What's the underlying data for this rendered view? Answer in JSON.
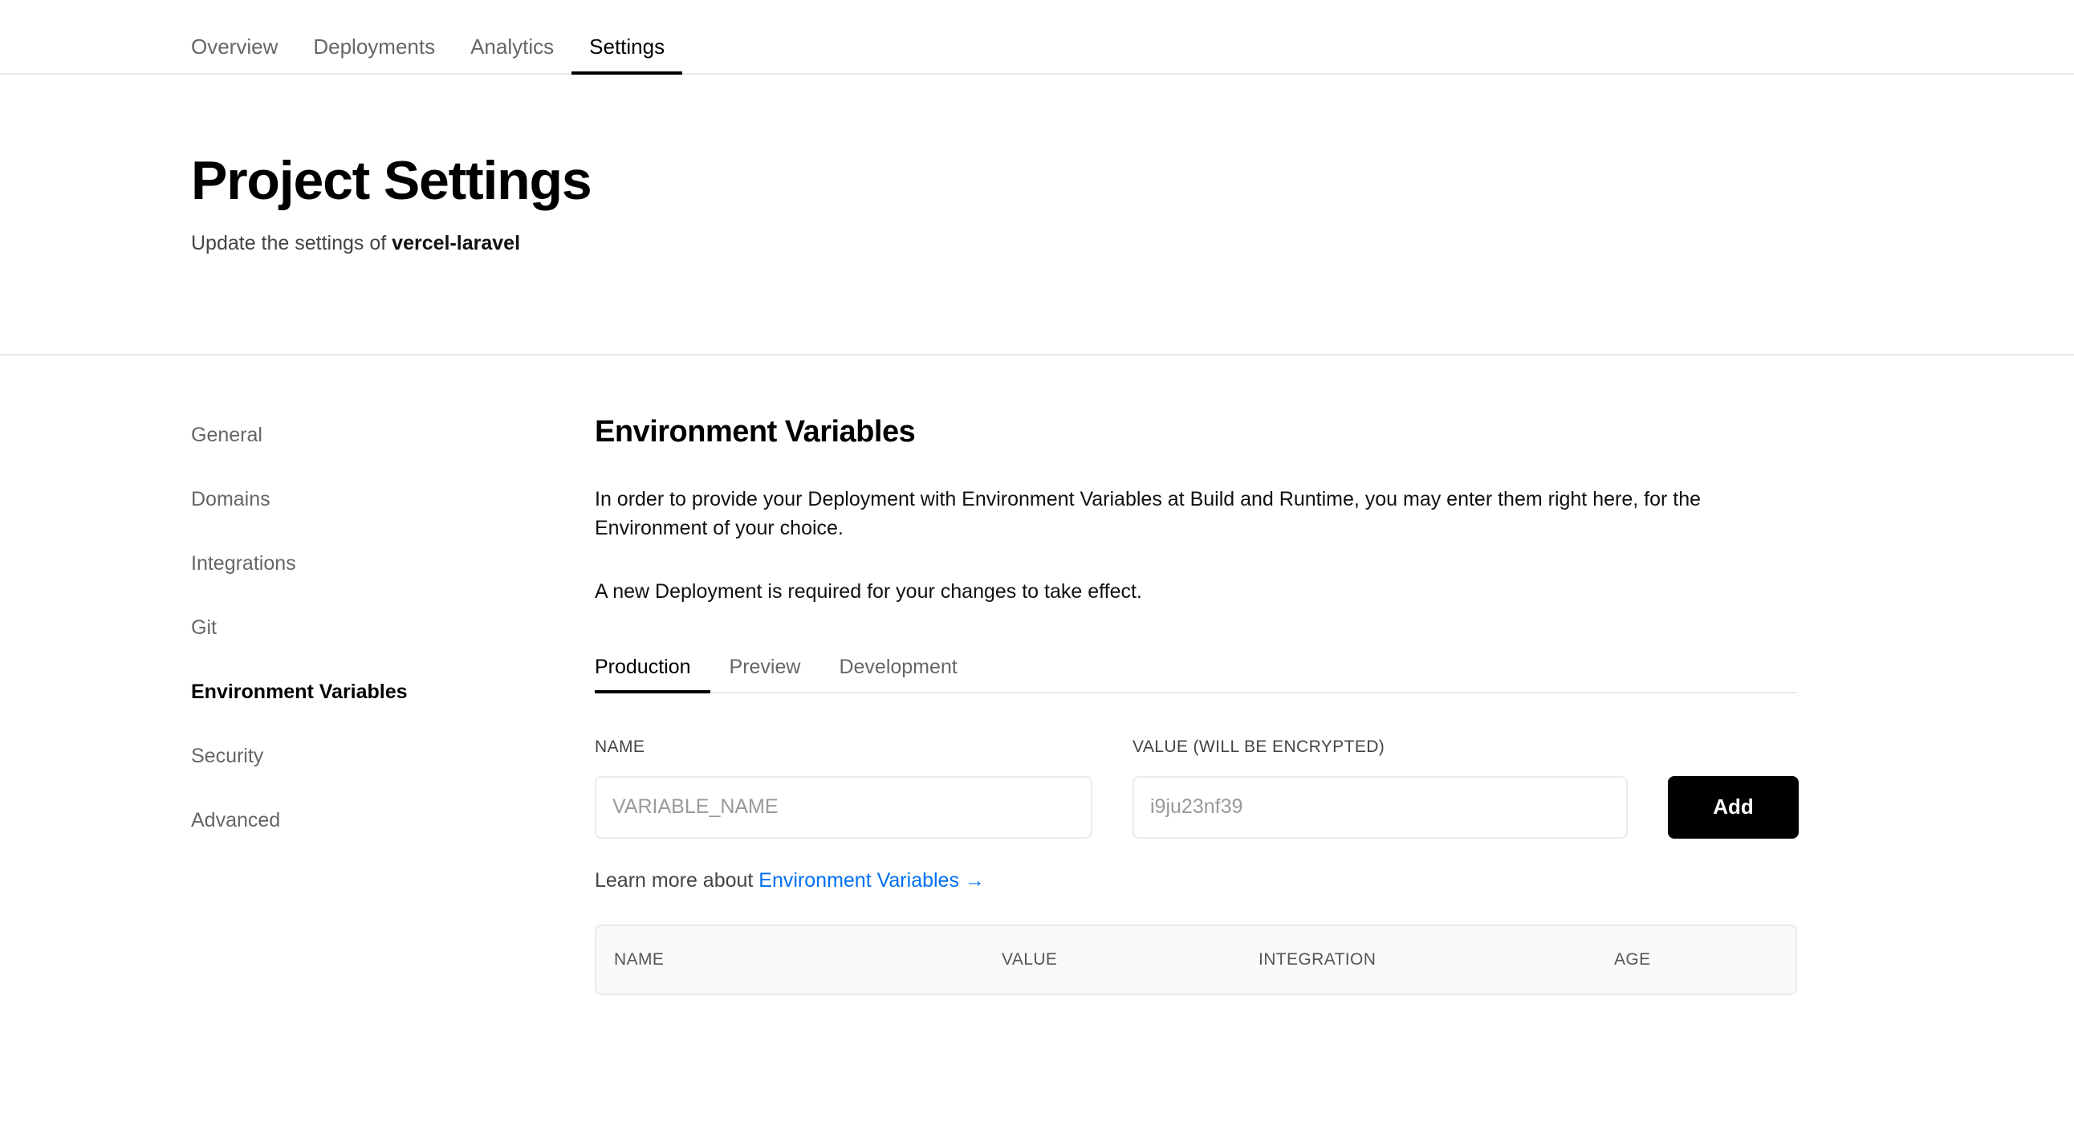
{
  "topnav": {
    "tabs": [
      {
        "label": "Overview",
        "active": false
      },
      {
        "label": "Deployments",
        "active": false
      },
      {
        "label": "Analytics",
        "active": false
      },
      {
        "label": "Settings",
        "active": true
      }
    ]
  },
  "header": {
    "title": "Project Settings",
    "subtitle_prefix": "Update the settings of ",
    "project_name": "vercel-laravel"
  },
  "sidebar": {
    "items": [
      {
        "label": "General",
        "active": false
      },
      {
        "label": "Domains",
        "active": false
      },
      {
        "label": "Integrations",
        "active": false
      },
      {
        "label": "Git",
        "active": false
      },
      {
        "label": "Environment Variables",
        "active": true
      },
      {
        "label": "Security",
        "active": false
      },
      {
        "label": "Advanced",
        "active": false
      }
    ]
  },
  "main": {
    "title": "Environment Variables",
    "paragraph_1": "In order to provide your Deployment with Environment Variables at Build and Runtime, you may enter them right here, for the Environment of your choice.",
    "paragraph_2": "A new Deployment is required for your changes to take effect.",
    "env_tabs": [
      {
        "label": "Production",
        "active": true
      },
      {
        "label": "Preview",
        "active": false
      },
      {
        "label": "Development",
        "active": false
      }
    ],
    "form": {
      "name_label": "NAME",
      "name_value": "",
      "name_placeholder": "VARIABLE_NAME",
      "value_label": "VALUE (WILL BE ENCRYPTED)",
      "value_value": "",
      "value_placeholder": "i9ju23nf39",
      "add_label": "Add"
    },
    "learn_more": {
      "text": "Learn more about ",
      "link_label": "Environment Variables",
      "arrow": "→"
    },
    "table": {
      "columns": [
        "NAME",
        "VALUE",
        "INTEGRATION",
        "AGE"
      ],
      "rows": []
    }
  },
  "colors": {
    "accent_link": "#0070f3",
    "active_underline": "#000000",
    "border": "#eaeaea",
    "table_bg": "#fafafa",
    "muted_text": "#666666"
  }
}
